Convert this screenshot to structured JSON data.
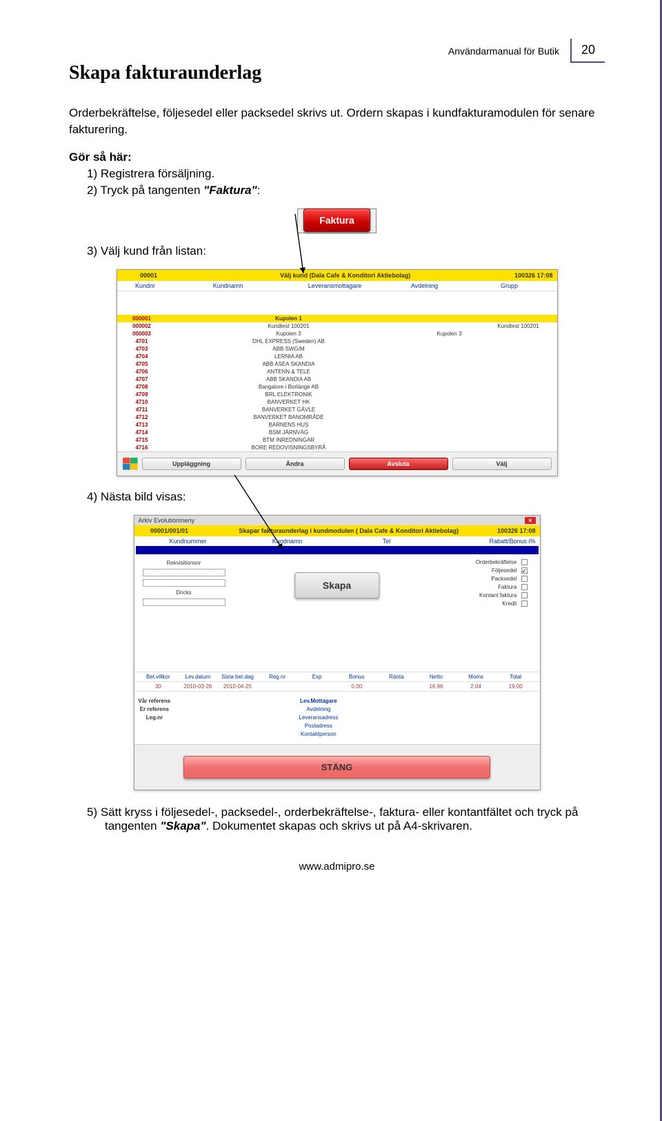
{
  "header": {
    "title": "Användarmanual för Butik",
    "page": "20"
  },
  "section_title": "Skapa fakturaunderlag",
  "intro": "Orderbekräftelse, följesedel eller packsedel skrivs ut. Ordern skapas i kundfakturamodulen för senare fakturering.",
  "gor": "Gör så här:",
  "step1": "1) Registrera försäljning.",
  "step2_pre": "2) Tryck på tangenten ",
  "step2_em": "\"Faktura\"",
  "step2_suf": ":",
  "faktura_btn": "Faktura",
  "step3": "3) Välj kund från listan:",
  "list": {
    "title_left": "00001",
    "title_center": "Välj kund (Dala Cafe & Konditori Aktiebolag)",
    "title_right": "100326 17:08",
    "columns": [
      "Kundnr",
      "Kundnamn",
      "Leveransmottagare",
      "Avdelning",
      "Grupp"
    ],
    "rows": [
      {
        "nr": "000001",
        "name": "Kupolen 1",
        "c3": "",
        "c4": "",
        "sel": true
      },
      {
        "nr": "000002",
        "name": "Kundtest 100201",
        "c3": "",
        "c4": "Kundtest 100201"
      },
      {
        "nr": "000003",
        "name": "Kupolen 3",
        "c3": "Kupolen 3",
        "c4": ""
      },
      {
        "nr": "4701",
        "name": "DHL EXPRESS (Sweden) AB"
      },
      {
        "nr": "4703",
        "name": "ABB SWG/M"
      },
      {
        "nr": "4704",
        "name": "LERNIA AB"
      },
      {
        "nr": "4705",
        "name": "ABB ASEA SKANDIA"
      },
      {
        "nr": "4706",
        "name": "ANTENN & TELE"
      },
      {
        "nr": "4707",
        "name": "ABB SKANDIA AB"
      },
      {
        "nr": "4708",
        "name": "Bangalore i Borlänge AB"
      },
      {
        "nr": "4709",
        "name": "BRL ELEKTRONIK"
      },
      {
        "nr": "4710",
        "name": "BANVERKET HK"
      },
      {
        "nr": "4711",
        "name": "BANVERKET GÄVLE"
      },
      {
        "nr": "4712",
        "name": "BANVERKET BANOMRÅDE"
      },
      {
        "nr": "4713",
        "name": "BARNENS HUS"
      },
      {
        "nr": "4714",
        "name": "BSM JÄRNVÄG"
      },
      {
        "nr": "4715",
        "name": "BTM INREDNINGAR"
      },
      {
        "nr": "4716",
        "name": "BORE REDOVISNINGSBYRÅ"
      }
    ],
    "buttons": [
      "Uppläggning",
      "Ändra",
      "Avsluta",
      "Välj"
    ]
  },
  "step4": "4) Nästa bild visas:",
  "form": {
    "menu": "Arkiv  Evolutionmeny",
    "title_left": "00001/001/01",
    "title_center": "Skapar fakturaunderlag i kundmodulen ( Dala Cafe & Konditori Aktiebolag)",
    "title_right": "100326 17:08",
    "columns2": [
      "Kundnummer",
      "Kundnamn",
      "Tel",
      "Rabatt/Bonus i%"
    ],
    "left_labels": [
      "Rekvisitionsnr",
      "Dricks"
    ],
    "checks": [
      {
        "label": "Orderbekräftelse",
        "checked": false
      },
      {
        "label": "Följesedel",
        "checked": true
      },
      {
        "label": "Packsedel",
        "checked": false
      },
      {
        "label": "Faktura",
        "checked": false
      },
      {
        "label": "Kontant faktura",
        "checked": false
      },
      {
        "label": "Kredit",
        "checked": false
      }
    ],
    "skapa": "Skapa",
    "numhead": [
      "Bet.villkor",
      "Lev.datum",
      "Sista bet.dag",
      "Reg.nr",
      "Exp",
      "Bonus",
      "Ränta",
      "Netto",
      "Moms",
      "Total"
    ],
    "numvals": [
      "30",
      "2010-03-26",
      "2010-04-25",
      "",
      "",
      "0.00",
      "",
      "16.96",
      "2.04",
      "19.00"
    ],
    "ref_left": [
      "Vår referens",
      "Er referens",
      "Leg.nr"
    ],
    "ref_mid_title": "Lev.Mottagare",
    "ref_mid": [
      "Avdelning",
      "Leveransadress",
      "Postadress",
      "Kontaktperson"
    ],
    "stang": "STÄNG"
  },
  "step5_pre": "5) Sätt kryss i följesedel-, packsedel-, orderbekräftelse-, faktura- eller kontantfältet och tryck på tangenten ",
  "step5_em": "\"Skapa\"",
  "step5_suf": ". Dokumentet skapas och skrivs ut på A4-skrivaren.",
  "footer": "www.admipro.se"
}
